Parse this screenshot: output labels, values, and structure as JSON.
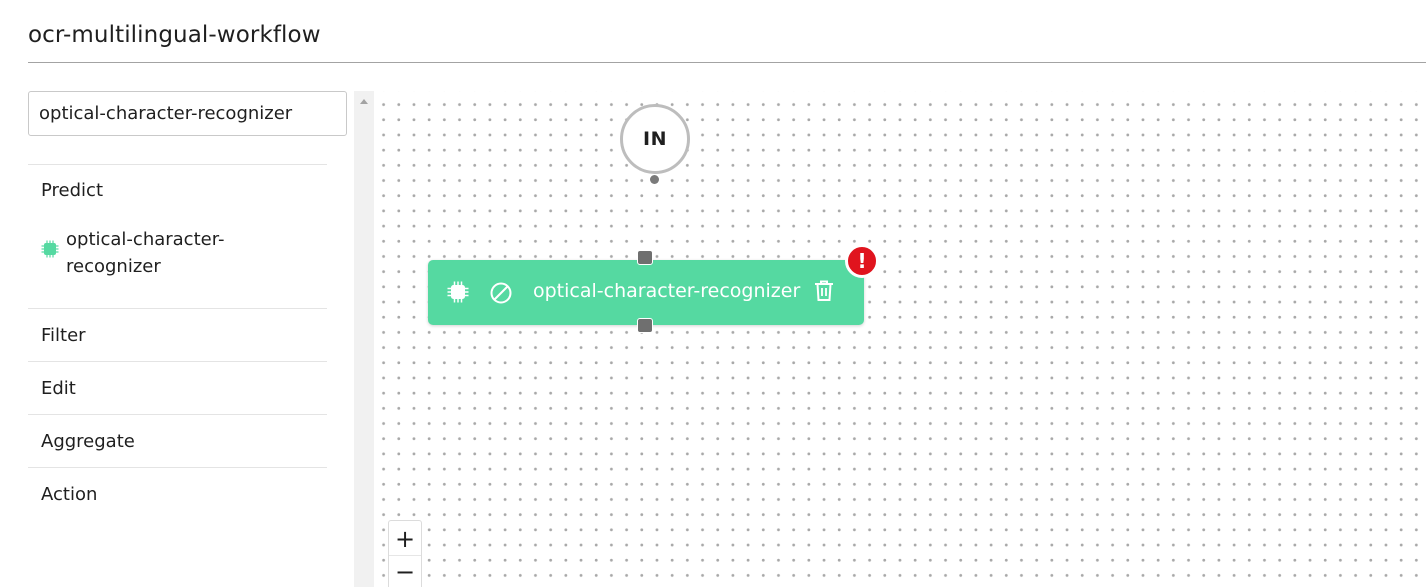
{
  "header": {
    "title": "ocr-multilingual-workflow"
  },
  "sidebar": {
    "search": {
      "value": "optical-character-recognizer"
    },
    "sections": [
      {
        "label": "Predict"
      },
      {
        "label": "Filter"
      },
      {
        "label": "Edit"
      },
      {
        "label": "Aggregate"
      },
      {
        "label": "Action"
      }
    ],
    "predict_items": [
      {
        "label": "optical-character-recognizer",
        "icon": "chip-icon"
      }
    ]
  },
  "canvas": {
    "input_node": {
      "label": "IN"
    },
    "nodes": [
      {
        "label": "optical-character-recognizer",
        "icon": "chip-icon",
        "status": "error",
        "error_badge": "!",
        "color": "#55d9a1"
      }
    ],
    "zoom": {
      "in_label": "+",
      "out_label": "−"
    }
  },
  "colors": {
    "node_green": "#55d9a1",
    "error_red": "#e0141e",
    "port_gray": "#6f6f6f"
  }
}
